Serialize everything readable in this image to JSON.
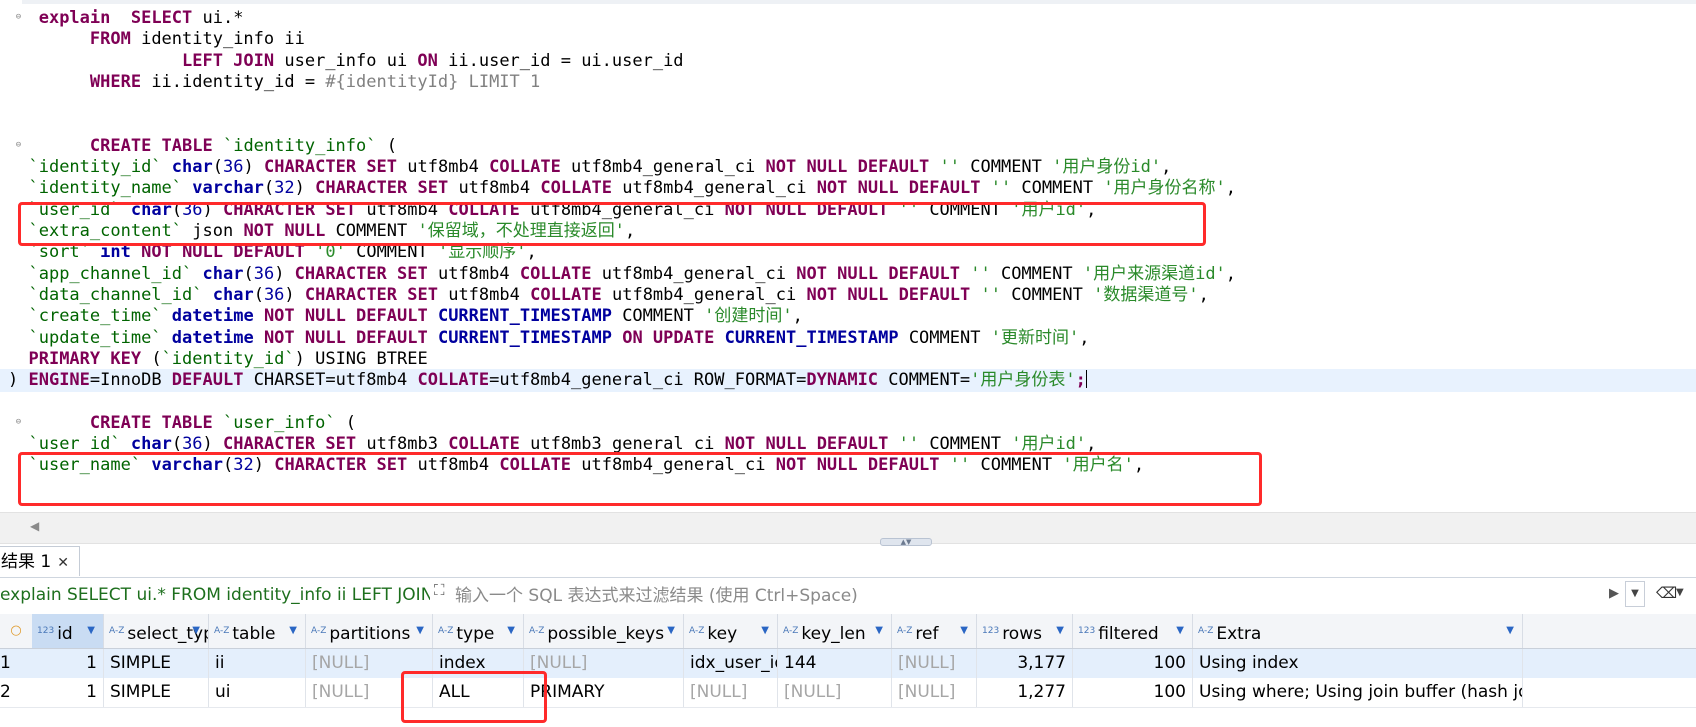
{
  "editor": {
    "lines": [
      [
        {
          "t": "   "
        },
        {
          "t": "explain",
          "c": "kw"
        },
        {
          "t": "  "
        },
        {
          "t": "SELECT",
          "c": "kw"
        },
        {
          "t": " ui.*"
        }
      ],
      [
        {
          "t": "        "
        },
        {
          "t": "FROM",
          "c": "kw"
        },
        {
          "t": " identity_info ii"
        }
      ],
      [
        {
          "t": "                 "
        },
        {
          "t": "LEFT JOIN",
          "c": "kw"
        },
        {
          "t": " user_info ui "
        },
        {
          "t": "ON",
          "c": "kw"
        },
        {
          "t": " ii.user_id = ui.user_id"
        }
      ],
      [
        {
          "t": "        "
        },
        {
          "t": "WHERE",
          "c": "kw"
        },
        {
          "t": " ii.identity_id = "
        },
        {
          "t": "#{identityId} LIMIT 1",
          "c": "ph"
        }
      ],
      [
        {
          "t": ""
        }
      ],
      [
        {
          "t": ""
        }
      ],
      [
        {
          "t": "        "
        },
        {
          "t": "CREATE TABLE",
          "c": "kw"
        },
        {
          "t": " "
        },
        {
          "t": "`identity_info`",
          "c": "tn"
        },
        {
          "t": " ("
        }
      ],
      [
        {
          "t": "  "
        },
        {
          "t": "`identity_id`",
          "c": "tn"
        },
        {
          "t": " "
        },
        {
          "t": "char",
          "c": "kb"
        },
        {
          "t": "("
        },
        {
          "t": "36",
          "c": "nm"
        },
        {
          "t": ") "
        },
        {
          "t": "CHARACTER SET",
          "c": "kw"
        },
        {
          "t": " utf8mb4 "
        },
        {
          "t": "COLLATE",
          "c": "kw"
        },
        {
          "t": " utf8mb4_general_ci "
        },
        {
          "t": "NOT NULL DEFAULT",
          "c": "kw"
        },
        {
          "t": " "
        },
        {
          "t": "''",
          "c": "st"
        },
        {
          "t": " COMMENT "
        },
        {
          "t": "'用户身份id'",
          "c": "st"
        },
        {
          "t": ","
        }
      ],
      [
        {
          "t": "  "
        },
        {
          "t": "`identity_name`",
          "c": "tn"
        },
        {
          "t": " "
        },
        {
          "t": "varchar",
          "c": "kb"
        },
        {
          "t": "("
        },
        {
          "t": "32",
          "c": "nm"
        },
        {
          "t": ") "
        },
        {
          "t": "CHARACTER SET",
          "c": "kw"
        },
        {
          "t": " utf8mb4 "
        },
        {
          "t": "COLLATE",
          "c": "kw"
        },
        {
          "t": " utf8mb4_general_ci "
        },
        {
          "t": "NOT NULL DEFAULT",
          "c": "kw"
        },
        {
          "t": " "
        },
        {
          "t": "''",
          "c": "st"
        },
        {
          "t": " COMMENT "
        },
        {
          "t": "'用户身份名称'",
          "c": "st"
        },
        {
          "t": ","
        }
      ],
      [
        {
          "t": "  "
        },
        {
          "t": "`user_id`",
          "c": "tn"
        },
        {
          "t": " "
        },
        {
          "t": "char",
          "c": "kb"
        },
        {
          "t": "("
        },
        {
          "t": "36",
          "c": "nm"
        },
        {
          "t": ") "
        },
        {
          "t": "CHARACTER SET",
          "c": "kw"
        },
        {
          "t": " utf8mb4 "
        },
        {
          "t": "COLLATE",
          "c": "kw"
        },
        {
          "t": " utf8mb4_general_ci "
        },
        {
          "t": "NOT NULL DEFAULT",
          "c": "kw"
        },
        {
          "t": " "
        },
        {
          "t": "''",
          "c": "st"
        },
        {
          "t": " COMMENT "
        },
        {
          "t": "'用户id'",
          "c": "st"
        },
        {
          "t": ","
        }
      ],
      [
        {
          "t": "  "
        },
        {
          "t": "`extra_content`",
          "c": "tn"
        },
        {
          "t": " json "
        },
        {
          "t": "NOT NULL",
          "c": "kw"
        },
        {
          "t": " COMMENT "
        },
        {
          "t": "'保留域，不处理直接返回'",
          "c": "st"
        },
        {
          "t": ","
        }
      ],
      [
        {
          "t": "  "
        },
        {
          "t": "`sort`",
          "c": "tn"
        },
        {
          "t": " "
        },
        {
          "t": "int",
          "c": "kb"
        },
        {
          "t": " "
        },
        {
          "t": "NOT NULL DEFAULT",
          "c": "kw"
        },
        {
          "t": " "
        },
        {
          "t": "'0'",
          "c": "st"
        },
        {
          "t": " COMMENT "
        },
        {
          "t": "'显示顺序'",
          "c": "st"
        },
        {
          "t": ","
        }
      ],
      [
        {
          "t": "  "
        },
        {
          "t": "`app_channel_id`",
          "c": "tn"
        },
        {
          "t": " "
        },
        {
          "t": "char",
          "c": "kb"
        },
        {
          "t": "("
        },
        {
          "t": "36",
          "c": "nm"
        },
        {
          "t": ") "
        },
        {
          "t": "CHARACTER SET",
          "c": "kw"
        },
        {
          "t": " utf8mb4 "
        },
        {
          "t": "COLLATE",
          "c": "kw"
        },
        {
          "t": " utf8mb4_general_ci "
        },
        {
          "t": "NOT NULL DEFAULT",
          "c": "kw"
        },
        {
          "t": " "
        },
        {
          "t": "''",
          "c": "st"
        },
        {
          "t": " COMMENT "
        },
        {
          "t": "'用户来源渠道id'",
          "c": "st"
        },
        {
          "t": ","
        }
      ],
      [
        {
          "t": "  "
        },
        {
          "t": "`data_channel_id`",
          "c": "tn"
        },
        {
          "t": " "
        },
        {
          "t": "char",
          "c": "kb"
        },
        {
          "t": "("
        },
        {
          "t": "36",
          "c": "nm"
        },
        {
          "t": ") "
        },
        {
          "t": "CHARACTER SET",
          "c": "kw"
        },
        {
          "t": " utf8mb4 "
        },
        {
          "t": "COLLATE",
          "c": "kw"
        },
        {
          "t": " utf8mb4_general_ci "
        },
        {
          "t": "NOT NULL DEFAULT",
          "c": "kw"
        },
        {
          "t": " "
        },
        {
          "t": "''",
          "c": "st"
        },
        {
          "t": " COMMENT "
        },
        {
          "t": "'数据渠道号'",
          "c": "st"
        },
        {
          "t": ","
        }
      ],
      [
        {
          "t": "  "
        },
        {
          "t": "`create_time`",
          "c": "tn"
        },
        {
          "t": " "
        },
        {
          "t": "datetime",
          "c": "kb"
        },
        {
          "t": " "
        },
        {
          "t": "NOT NULL DEFAULT",
          "c": "kw"
        },
        {
          "t": " "
        },
        {
          "t": "CURRENT_TIMESTAMP",
          "c": "kb"
        },
        {
          "t": " COMMENT "
        },
        {
          "t": "'创建时间'",
          "c": "st"
        },
        {
          "t": ","
        }
      ],
      [
        {
          "t": "  "
        },
        {
          "t": "`update_time`",
          "c": "tn"
        },
        {
          "t": " "
        },
        {
          "t": "datetime",
          "c": "kb"
        },
        {
          "t": " "
        },
        {
          "t": "NOT NULL DEFAULT",
          "c": "kw"
        },
        {
          "t": " "
        },
        {
          "t": "CURRENT_TIMESTAMP",
          "c": "kb"
        },
        {
          "t": " "
        },
        {
          "t": "ON UPDATE",
          "c": "kw"
        },
        {
          "t": " "
        },
        {
          "t": "CURRENT_TIMESTAMP",
          "c": "kb"
        },
        {
          "t": " COMMENT "
        },
        {
          "t": "'更新时间'",
          "c": "st"
        },
        {
          "t": ","
        }
      ],
      [
        {
          "t": "  "
        },
        {
          "t": "PRIMARY KEY",
          "c": "kw"
        },
        {
          "t": " ("
        },
        {
          "t": "`identity_id`",
          "c": "tn"
        },
        {
          "t": ") USING BTREE"
        }
      ],
      [
        {
          "t": ") "
        },
        {
          "t": "ENGINE",
          "c": "kw"
        },
        {
          "t": "=InnoDB "
        },
        {
          "t": "DEFAULT",
          "c": "kw"
        },
        {
          "t": " CHARSET=utf8mb4 "
        },
        {
          "t": "COLLATE",
          "c": "kw"
        },
        {
          "t": "=utf8mb4_general_ci ROW_FORMAT="
        },
        {
          "t": "DYNAMIC",
          "c": "kw"
        },
        {
          "t": " COMMENT="
        },
        {
          "t": "'用户身份表'",
          "c": "st"
        },
        {
          "t": ";",
          "c": "kw"
        }
      ],
      [
        {
          "t": ""
        }
      ],
      [
        {
          "t": "        "
        },
        {
          "t": "CREATE TABLE",
          "c": "kw"
        },
        {
          "t": " "
        },
        {
          "t": "`user_info`",
          "c": "tn"
        },
        {
          "t": " ("
        }
      ],
      [
        {
          "t": "  "
        },
        {
          "t": "`user_id`",
          "c": "tn"
        },
        {
          "t": " "
        },
        {
          "t": "char",
          "c": "kb"
        },
        {
          "t": "("
        },
        {
          "t": "36",
          "c": "nm"
        },
        {
          "t": ") "
        },
        {
          "t": "CHARACTER SET",
          "c": "kw"
        },
        {
          "t": " utf8mb3 "
        },
        {
          "t": "COLLATE",
          "c": "kw"
        },
        {
          "t": " utf8mb3_general_ci "
        },
        {
          "t": "NOT NULL DEFAULT",
          "c": "kw"
        },
        {
          "t": " "
        },
        {
          "t": "''",
          "c": "st"
        },
        {
          "t": " COMMENT "
        },
        {
          "t": "'用户id'",
          "c": "st"
        },
        {
          "t": ","
        }
      ],
      [
        {
          "t": "  "
        },
        {
          "t": "`user_name`",
          "c": "tn"
        },
        {
          "t": " "
        },
        {
          "t": "varchar",
          "c": "kb"
        },
        {
          "t": "("
        },
        {
          "t": "32",
          "c": "nm"
        },
        {
          "t": ") "
        },
        {
          "t": "CHARACTER SET",
          "c": "kw"
        },
        {
          "t": " utf8mb4 "
        },
        {
          "t": "COLLATE",
          "c": "kw"
        },
        {
          "t": " utf8mb4_general_ci "
        },
        {
          "t": "NOT NULL DEFAULT",
          "c": "kw"
        },
        {
          "t": " "
        },
        {
          "t": "''",
          "c": "st"
        },
        {
          "t": " COMMENT "
        },
        {
          "t": "'用户名'",
          "c": "st"
        },
        {
          "t": ","
        }
      ]
    ],
    "current_line": 17,
    "fold_markers": [
      0,
      6,
      19
    ]
  },
  "results": {
    "tab_label": "结果 1",
    "query_preview": "explain SELECT ui.* FROM identity_info ii LEFT JOIN user_",
    "filter_placeholder": "输入一个 SQL 表达式来过滤结果 (使用 Ctrl+Space)",
    "columns": [
      {
        "name": "id",
        "type": "123"
      },
      {
        "name": "select_type",
        "type": "A-Z"
      },
      {
        "name": "table",
        "type": "A-Z"
      },
      {
        "name": "partitions",
        "type": "A-Z"
      },
      {
        "name": "type",
        "type": "A-Z"
      },
      {
        "name": "possible_keys",
        "type": "A-Z"
      },
      {
        "name": "key",
        "type": "A-Z"
      },
      {
        "name": "key_len",
        "type": "A-Z"
      },
      {
        "name": "ref",
        "type": "A-Z"
      },
      {
        "name": "rows",
        "type": "123"
      },
      {
        "name": "filtered",
        "type": "123"
      },
      {
        "name": "Extra",
        "type": "A-Z"
      }
    ],
    "rows": [
      {
        "num": "1",
        "cells": [
          "1",
          "SIMPLE",
          "ii",
          "[NULL]",
          "index",
          "[NULL]",
          "idx_user_id",
          "144",
          "[NULL]",
          "3,177",
          "100",
          "Using index"
        ]
      },
      {
        "num": "2",
        "cells": [
          "1",
          "SIMPLE",
          "ui",
          "[NULL]",
          "ALL",
          "PRIMARY",
          "[NULL]",
          "[NULL]",
          "[NULL]",
          "1,277",
          "100",
          "Using where; Using join buffer (hash join)"
        ]
      }
    ]
  },
  "colors": {
    "highlight": "#ff2a2a",
    "keyword": "#7f0055",
    "string": "#2a8a2a",
    "row_selected": "#e4effc"
  }
}
